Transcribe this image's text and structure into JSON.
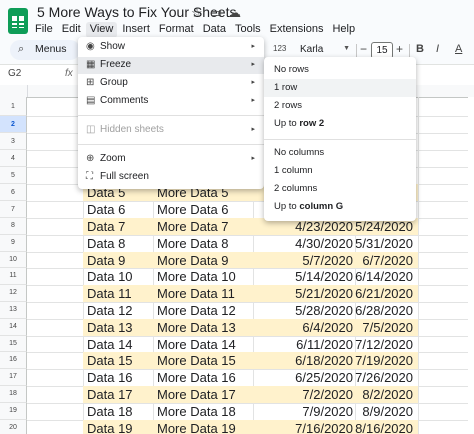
{
  "title_bar": {
    "doc_title": "5 More Ways to Fix Your Sheets",
    "star_icon": "☆",
    "folder_icon": "▭",
    "cloud_icon": "☁"
  },
  "menu_bar": {
    "items": [
      "File",
      "Edit",
      "View",
      "Insert",
      "Format",
      "Data",
      "Tools",
      "Extensions",
      "Help"
    ],
    "active": "View"
  },
  "toolbar": {
    "menus_label": "Menus",
    "number_format": "123",
    "font": "Karla",
    "decrease": "−",
    "font_size": "15",
    "increase": "+",
    "bold": "B",
    "italic": "I",
    "more": "A"
  },
  "formula_bar": {
    "cell_ref": "G2",
    "fx": "fx"
  },
  "row_numbers": [
    "1",
    "2",
    "3",
    "4",
    "5",
    "6",
    "7",
    "8",
    "9",
    "10",
    "11",
    "12",
    "13",
    "14",
    "15",
    "16",
    "17",
    "18",
    "19",
    "20"
  ],
  "selected_row": "2",
  "rows": [
    {
      "a": "Data 5",
      "b": "More Data 5",
      "c": "",
      "d": ""
    },
    {
      "a": "Data 6",
      "b": "More Data 6",
      "c": "",
      "d": ""
    },
    {
      "a": "Data 7",
      "b": "More Data 7",
      "c": "4/23/2020",
      "d": "5/24/2020"
    },
    {
      "a": "Data 8",
      "b": "More Data 8",
      "c": "4/30/2020",
      "d": "5/31/2020"
    },
    {
      "a": "Data 9",
      "b": "More Data 9",
      "c": "5/7/2020",
      "d": "6/7/2020"
    },
    {
      "a": "Data 10",
      "b": "More Data 10",
      "c": "5/14/2020",
      "d": "6/14/2020"
    },
    {
      "a": "Data 11",
      "b": "More Data 11",
      "c": "5/21/2020",
      "d": "6/21/2020"
    },
    {
      "a": "Data 12",
      "b": "More Data 12",
      "c": "5/28/2020",
      "d": "6/28/2020"
    },
    {
      "a": "Data 13",
      "b": "More Data 13",
      "c": "6/4/2020",
      "d": "7/5/2020"
    },
    {
      "a": "Data 14",
      "b": "More Data 14",
      "c": "6/11/2020",
      "d": "7/12/2020"
    },
    {
      "a": "Data 15",
      "b": "More Data 15",
      "c": "6/18/2020",
      "d": "7/19/2020"
    },
    {
      "a": "Data 16",
      "b": "More Data 16",
      "c": "6/25/2020",
      "d": "7/26/2020"
    },
    {
      "a": "Data 17",
      "b": "More Data 17",
      "c": "7/2/2020",
      "d": "8/2/2020"
    },
    {
      "a": "Data 18",
      "b": "More Data 18",
      "c": "7/9/2020",
      "d": "8/9/2020"
    },
    {
      "a": "Data 19",
      "b": "More Data 19",
      "c": "7/16/2020",
      "d": "8/16/2020"
    }
  ],
  "view_menu": {
    "items": [
      {
        "label": "Show",
        "icon": "◉",
        "arrow": "▸"
      },
      {
        "label": "Freeze",
        "icon": "▦",
        "arrow": "▸"
      },
      {
        "label": "Group",
        "icon": "⊞",
        "arrow": "▸"
      },
      {
        "label": "Comments",
        "icon": "▤",
        "arrow": "▸"
      },
      {
        "label": "Hidden sheets",
        "icon": "◫",
        "arrow": "▸"
      },
      {
        "label": "Zoom",
        "icon": "⊕",
        "arrow": "▸"
      },
      {
        "label": "Full screen",
        "icon": "⛶",
        "arrow": ""
      }
    ]
  },
  "freeze_menu": {
    "no_rows": "No rows",
    "one_row": "1 row",
    "two_rows": "2 rows",
    "up_to_row_prefix": "Up to",
    "up_to_row_value": "row 2",
    "no_columns": "No columns",
    "one_column": "1 column",
    "two_columns": "2 columns",
    "up_to_col_prefix": "Up to",
    "up_to_col_value": "column G"
  },
  "colors": {
    "band": "#fff2cc",
    "selected_row": "#d3e3fd",
    "sheets_green": "#0f9d58"
  }
}
